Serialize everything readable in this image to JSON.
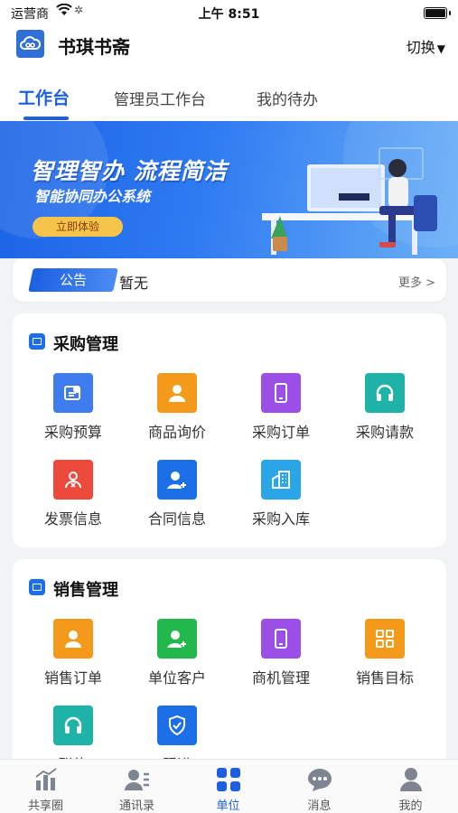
{
  "status_bar": {
    "carrier": "运营商",
    "time": "上午 8:51"
  },
  "app": {
    "title": "书琪书斋",
    "switch_label": "切换"
  },
  "tabs": [
    {
      "label": "工作台",
      "active": true
    },
    {
      "label": "管理员工作台",
      "active": false
    },
    {
      "label": "我的待办",
      "active": false
    }
  ],
  "banner": {
    "headline": "智理智办 流程简洁",
    "subline": "智能协同办公系统",
    "cta": "立即体验"
  },
  "notice": {
    "tag": "公告",
    "text": "暂无",
    "more": "更多 >"
  },
  "purchase": {
    "title": "采购管理",
    "items": [
      {
        "label": "采购预算",
        "icon": "budget-icon",
        "color": "#3f7cf0"
      },
      {
        "label": "商品询价",
        "icon": "person-icon",
        "color": "#f39a1b"
      },
      {
        "label": "采购订单",
        "icon": "phone-icon",
        "color": "#9b4fe6"
      },
      {
        "label": "采购请款",
        "icon": "headset-icon",
        "color": "#1fb2a6"
      },
      {
        "label": "发票信息",
        "icon": "invoice-person-icon",
        "color": "#ec4a3b"
      },
      {
        "label": "合同信息",
        "icon": "add-person-icon",
        "color": "#1d6fe8"
      },
      {
        "label": "采购入库",
        "icon": "building-icon",
        "color": "#2aa6e8"
      }
    ]
  },
  "sales": {
    "title": "销售管理",
    "items": [
      {
        "label": "销售订单",
        "icon": "person-icon",
        "color": "#f39a1b"
      },
      {
        "label": "单位客户",
        "icon": "add-person-icon",
        "color": "#22b84c"
      },
      {
        "label": "商机管理",
        "icon": "phone-icon",
        "color": "#9b4fe6"
      },
      {
        "label": "销售目标",
        "icon": "grid-icon",
        "color": "#f39a1b"
      },
      {
        "label": "联络",
        "icon": "headset-icon",
        "color": "#1fb2a6"
      },
      {
        "label": "跟进",
        "icon": "shield-icon",
        "color": "#1d6fe8"
      }
    ]
  },
  "tabbar": [
    {
      "label": "共享圈",
      "icon": "chart-icon",
      "active": false
    },
    {
      "label": "通讯录",
      "icon": "contacts-icon",
      "active": false
    },
    {
      "label": "单位",
      "icon": "apps-icon",
      "active": true
    },
    {
      "label": "消息",
      "icon": "chat-icon",
      "active": false
    },
    {
      "label": "我的",
      "icon": "user-icon",
      "active": false
    }
  ],
  "colors": {
    "accent": "#1c5fe0",
    "background": "#f2f3f5"
  }
}
